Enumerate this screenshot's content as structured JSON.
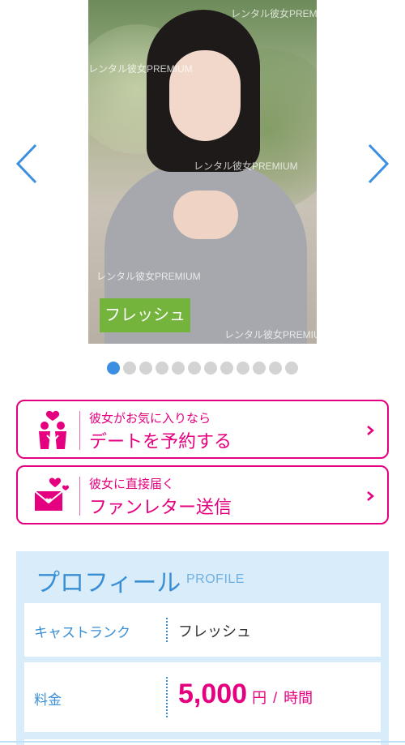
{
  "gallery": {
    "watermark": "レンタル彼女PREMIUM",
    "rank_badge": "フレッシュ",
    "prev_icon": "chevron-left-icon",
    "next_icon": "chevron-right-icon",
    "accent_color": "#3c8fe0",
    "dots": [
      {
        "active": true
      },
      {
        "active": false
      },
      {
        "active": false
      },
      {
        "active": false
      },
      {
        "active": false
      },
      {
        "active": false
      },
      {
        "active": false
      },
      {
        "active": false
      },
      {
        "active": false
      },
      {
        "active": false
      },
      {
        "active": false
      },
      {
        "active": false
      }
    ]
  },
  "actions": {
    "reserve": {
      "sub": "彼女がお気に入りなら",
      "main": "デートを予約する",
      "icon": "couple-heart-icon"
    },
    "letter": {
      "sub": "彼女に直接届く",
      "main": "ファンレター送信",
      "icon": "love-letter-icon"
    },
    "color": "#e5007f"
  },
  "profile": {
    "title": "プロフィール",
    "subtitle": "PROFILE",
    "rank_label": "キャストランク",
    "rank_value": "フレッシュ",
    "price_label": "料金",
    "price_amount": "5,000",
    "price_unit": "円",
    "price_slash": "/",
    "price_per": "時間",
    "bg_color": "#d8ecfa",
    "label_color": "#3a8fd4"
  }
}
